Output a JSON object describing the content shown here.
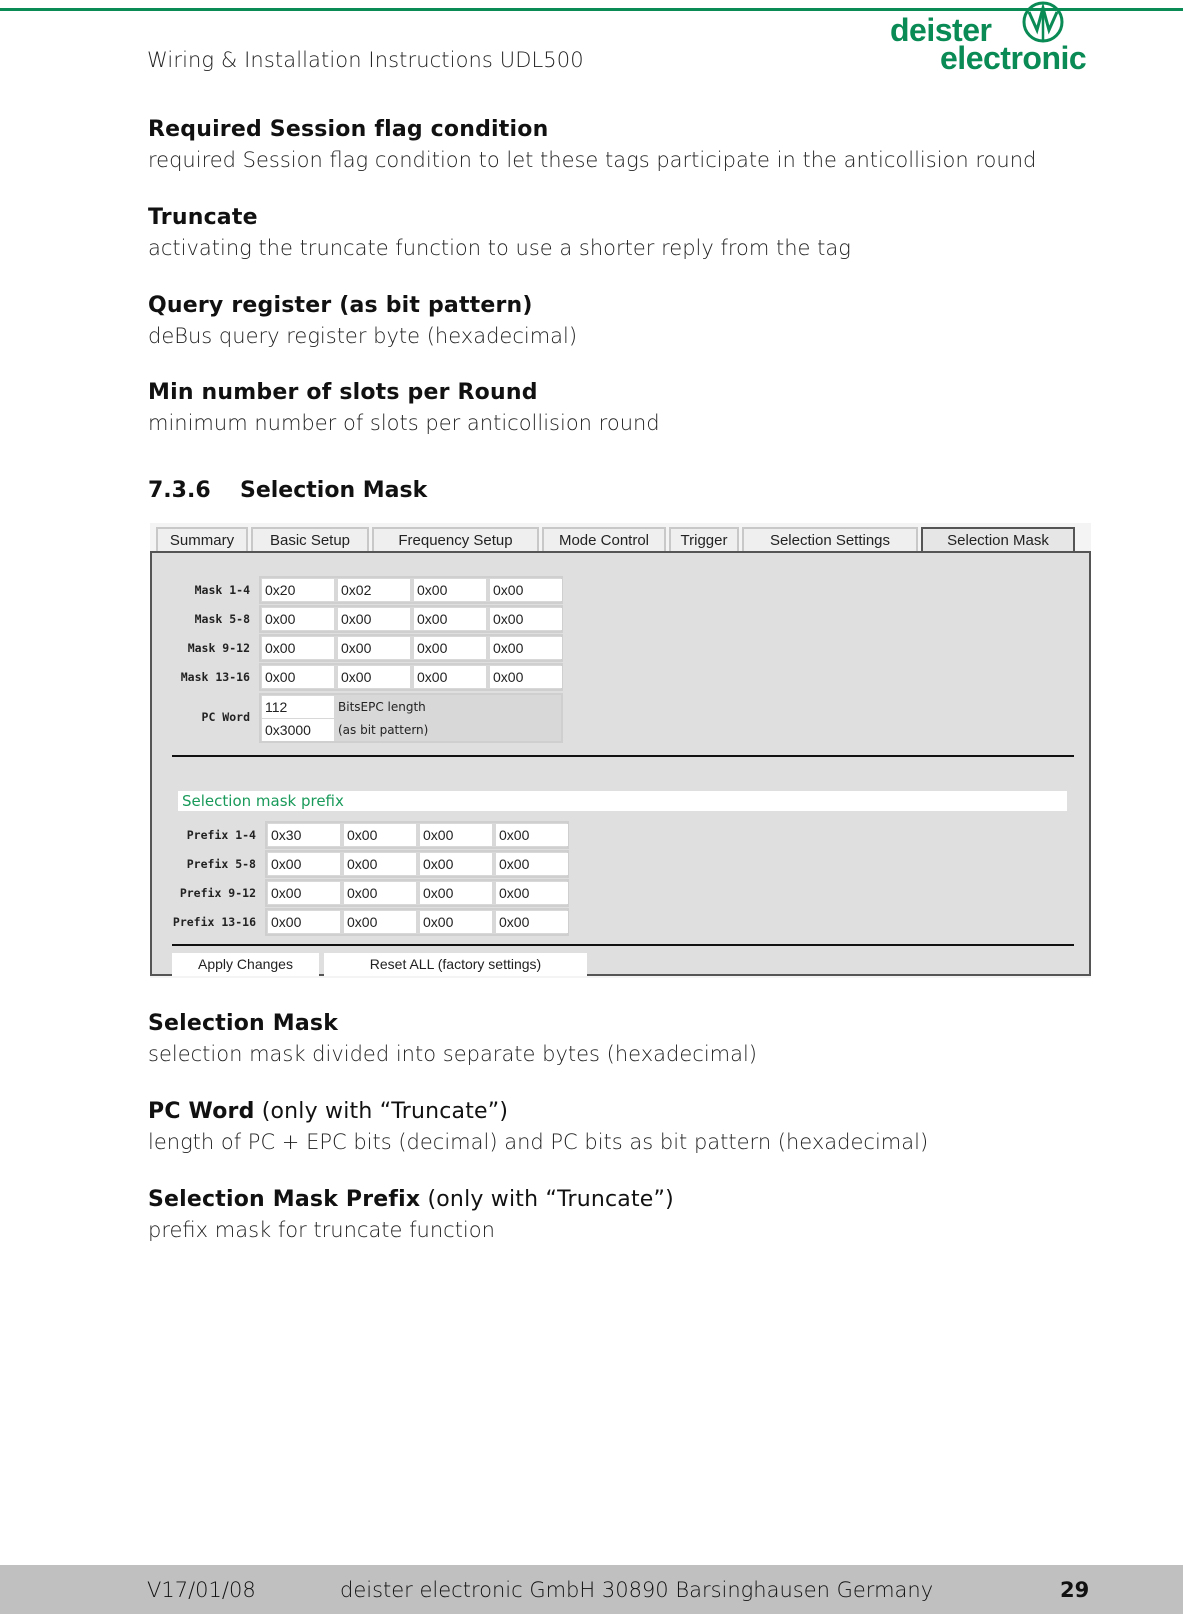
{
  "header": {
    "title": "Wiring & Installation Instructions UDL500",
    "logo_line1": "deister",
    "logo_line2": "electronic",
    "brand_color": "#0a8a55"
  },
  "sections_top": [
    {
      "heading": "Required Session flag condition",
      "text": "required Session flag condition to let these tags participate in the anticollision round"
    },
    {
      "heading": "Truncate",
      "text": "activating the truncate function to use a shorter reply from the tag"
    },
    {
      "heading": "Query register (as bit pattern)",
      "text": "deBus query register byte (hexadecimal)"
    },
    {
      "heading": "Min number of slots per Round",
      "text": "minimum number of slots per anticollision round"
    }
  ],
  "subsection": {
    "number": "7.3.6",
    "title": "Selection Mask"
  },
  "ui": {
    "tabs": [
      {
        "label": "Summary",
        "active": false
      },
      {
        "label": "Basic Setup",
        "active": false
      },
      {
        "label": "Frequency Setup",
        "active": false
      },
      {
        "label": "Mode Control",
        "active": false
      },
      {
        "label": "Trigger",
        "active": false
      },
      {
        "label": "Selection Settings",
        "active": false
      },
      {
        "label": "Selection Mask",
        "active": true
      }
    ],
    "mask_rows": [
      {
        "label": "Mask 1-4",
        "values": [
          "0x20",
          "0x02",
          "0x00",
          "0x00"
        ]
      },
      {
        "label": "Mask 5-8",
        "values": [
          "0x00",
          "0x00",
          "0x00",
          "0x00"
        ]
      },
      {
        "label": "Mask 9-12",
        "values": [
          "0x00",
          "0x00",
          "0x00",
          "0x00"
        ]
      },
      {
        "label": "Mask 13-16",
        "values": [
          "0x00",
          "0x00",
          "0x00",
          "0x00"
        ]
      }
    ],
    "pc_word": {
      "label": "PC Word",
      "length_value": "112",
      "length_caption": "BitsEPC length",
      "pattern_value": "0x3000",
      "pattern_caption": "(as bit pattern)"
    },
    "prefix_title": "Selection mask prefix",
    "prefix_rows": [
      {
        "label": "Prefix 1-4",
        "values": [
          "0x30",
          "0x00",
          "0x00",
          "0x00"
        ]
      },
      {
        "label": "Prefix 5-8",
        "values": [
          "0x00",
          "0x00",
          "0x00",
          "0x00"
        ]
      },
      {
        "label": "Prefix 9-12",
        "values": [
          "0x00",
          "0x00",
          "0x00",
          "0x00"
        ]
      },
      {
        "label": "Prefix 13-16",
        "values": [
          "0x00",
          "0x00",
          "0x00",
          "0x00"
        ]
      }
    ],
    "buttons": {
      "apply": "Apply Changes",
      "reset": "Reset ALL (factory settings)"
    }
  },
  "sections_bottom": [
    {
      "heading": "Selection Mask",
      "note": "",
      "text": "selection mask divided into separate bytes (hexadecimal)"
    },
    {
      "heading": "PC Word",
      "note": " (only with “Truncate”)",
      "text": "length of PC + EPC bits (decimal) and PC bits as bit pattern (hexadecimal)"
    },
    {
      "heading": "Selection Mask Prefix",
      "note": " (only with “Truncate”)",
      "text": "prefix mask for truncate function"
    }
  ],
  "footer": {
    "version": "V17/01/08",
    "company": "deister electronic GmbH  30890 Barsinghausen  Germany",
    "page": "29"
  }
}
